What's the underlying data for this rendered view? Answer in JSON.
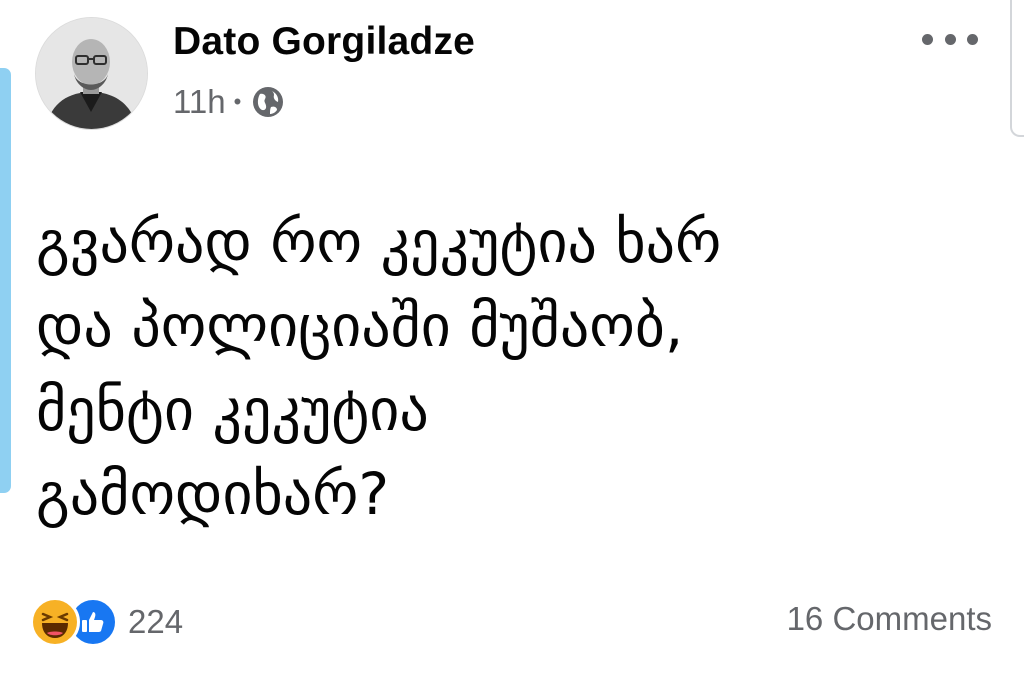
{
  "post": {
    "author": "Dato Gorgiladze",
    "time": "11h",
    "separator": "•",
    "privacy_icon": "globe-icon",
    "menu_icon": "more-options-icon",
    "text": "გვარად რო კეკუტია ხარ\nდა პოლიციაში მუშაობ,\nმენტი კეკუტია\nგამოდიხარ?"
  },
  "reactions": {
    "icons": [
      "haha-reaction-icon",
      "like-reaction-icon"
    ],
    "count": "224",
    "comments": "16 Comments"
  },
  "colors": {
    "text": "#050505",
    "secondary": "#65676b",
    "like_blue": "#1877f2",
    "haha_yellow": "#f7b125",
    "accent_bar": "#8fd0f2"
  }
}
